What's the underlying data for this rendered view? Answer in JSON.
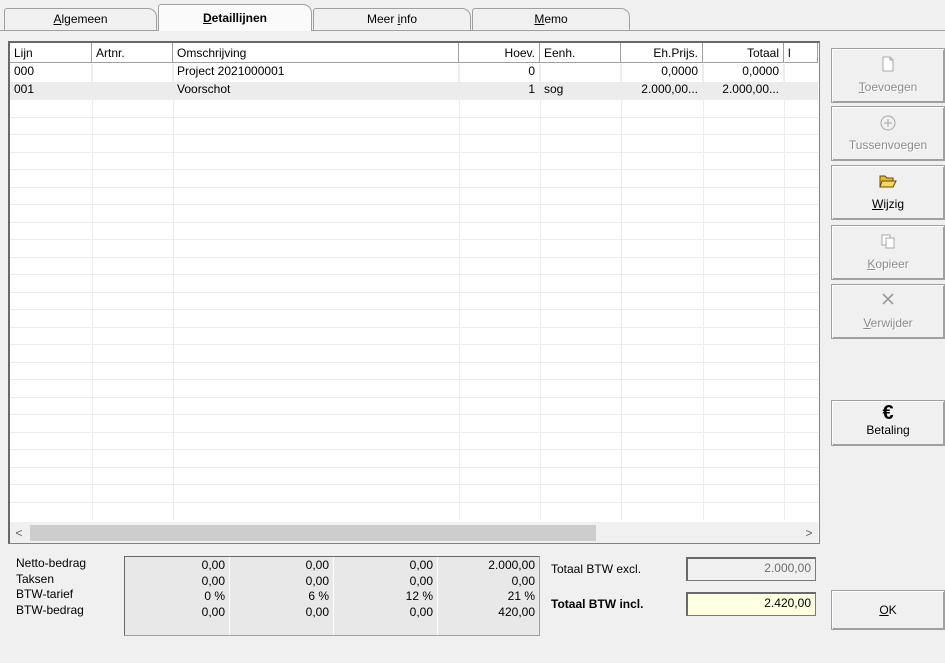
{
  "tabs": [
    {
      "label": "Algemeen",
      "active": false
    },
    {
      "label": "Detaillijnen",
      "active": true
    },
    {
      "label": "Meer info",
      "active": false
    },
    {
      "label": "Memo",
      "active": false
    }
  ],
  "grid": {
    "columns": [
      "Lijn",
      "Artnr.",
      "Omschrijving",
      "Hoev.",
      "Eenh.",
      "Eh.Prijs.",
      "Totaal",
      "l"
    ],
    "rows": [
      [
        "000",
        "",
        "Project 2021000001",
        "0",
        "",
        "0,0000",
        "0,0000"
      ],
      [
        "001",
        "",
        "Voorschot",
        "1",
        "sog",
        "2.000,00...",
        "2.000,00..."
      ]
    ],
    "scroll_left": "<",
    "scroll_right": ">"
  },
  "buttons": {
    "toevoegen": "Toevoegen",
    "tussenvoegen": "Tussenvoegen",
    "wijzig": "Wijzig",
    "kopieer": "Kopieer",
    "verwijder": "Verwijder",
    "betaling": "Betaling",
    "betaling_symbol": "€",
    "ok": "OK"
  },
  "icons": {
    "toevoegen": "new-document-icon",
    "tussenvoegen": "insert-icon",
    "wijzig": "open-folder-icon",
    "kopieer": "copy-icon",
    "verwijder": "delete-x-icon"
  },
  "summary": {
    "labels": [
      "Netto-bedrag",
      "Taksen",
      "BTW-tarief",
      "BTW-bedrag"
    ],
    "columns": [
      [
        "0,00",
        "0,00",
        "0 %",
        "0,00"
      ],
      [
        "0,00",
        "0,00",
        "6 %",
        "0,00"
      ],
      [
        "0,00",
        "0,00",
        "12 %",
        "0,00"
      ],
      [
        "2.000,00",
        "0,00",
        "21 %",
        "420,00"
      ]
    ],
    "totaal_excl_label": "Totaal BTW excl.",
    "totaal_excl_value": "2.000,00",
    "totaal_incl_label": "Totaal BTW incl.",
    "totaal_incl_value": "2.420,00"
  },
  "colors": {
    "incl_field_bg": "#ffffe1",
    "excl_field_bg": "#f0f0f0"
  }
}
